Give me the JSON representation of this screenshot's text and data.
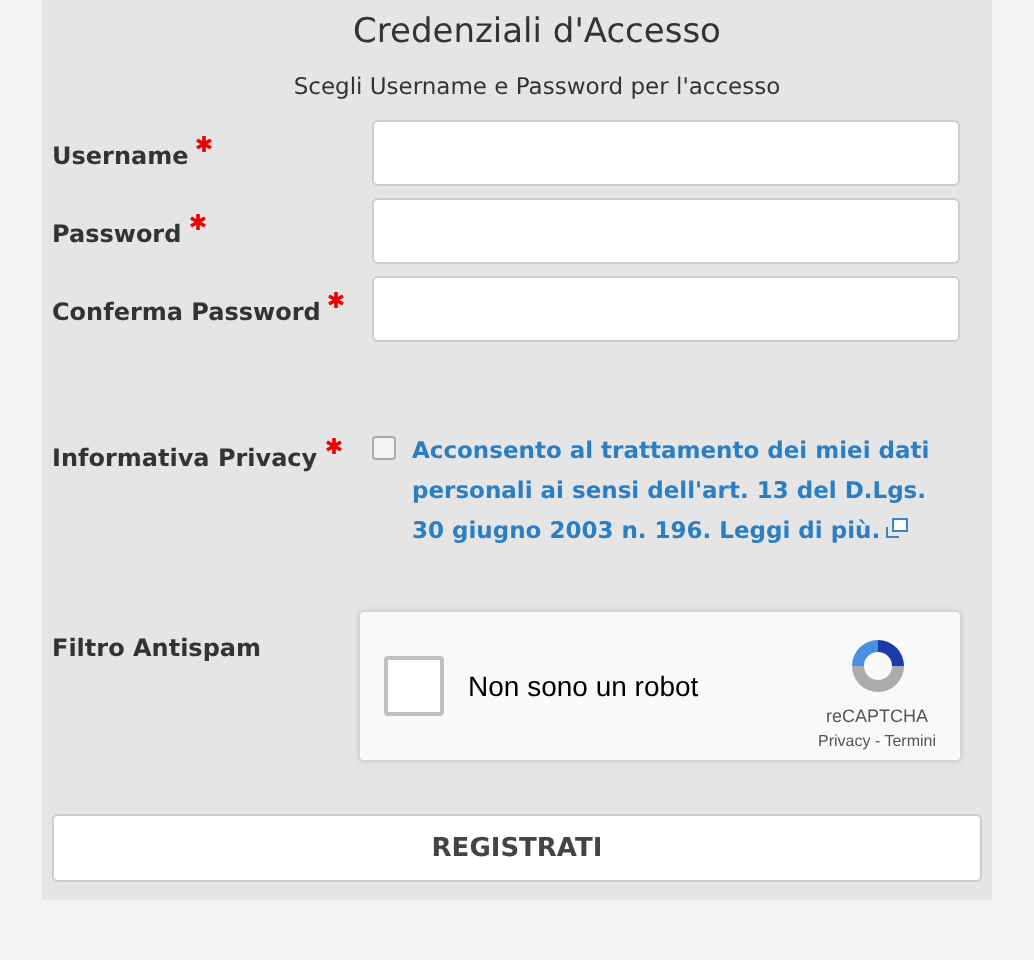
{
  "title": "Credenziali d'Accesso",
  "subtitle": "Scegli Username e Password per l'accesso",
  "fields": [
    {
      "label": "Username",
      "required": true
    },
    {
      "label": "Password",
      "required": true
    },
    {
      "label": "Conferma Password",
      "required": true
    }
  ],
  "privacy": {
    "label": "Informativa Privacy",
    "required": true,
    "checked": false,
    "text": "Acconsento al trattamento dei miei dati personali ai sensi dell'art. 13 del D.Lgs. 30 giugno 2003 n. 196. Leggi di più."
  },
  "antispam": {
    "label": "Filtro Antispam",
    "captcha": {
      "checked": false,
      "text": "Non sono un robot",
      "brand": "reCAPTCHA",
      "links": "Privacy - Termini"
    }
  },
  "submit": "REGISTRATI"
}
